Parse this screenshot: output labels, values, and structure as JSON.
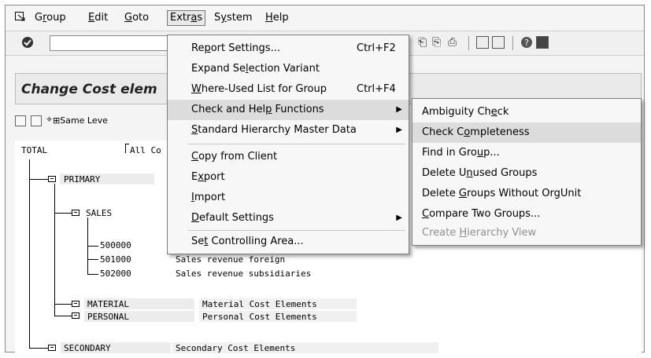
{
  "menubar": {
    "items": [
      {
        "pre": "G",
        "ul": "r",
        "post": "oup"
      },
      {
        "pre": "",
        "ul": "E",
        "post": "dit"
      },
      {
        "pre": "",
        "ul": "G",
        "post": "oto"
      },
      {
        "pre": "Extr",
        "ul": "a",
        "post": "s"
      },
      {
        "pre": "S",
        "ul": "y",
        "post": "stem"
      },
      {
        "pre": "",
        "ul": "H",
        "post": "elp"
      }
    ]
  },
  "page": {
    "title": "Change Cost elem",
    "same_level": "Same Leve"
  },
  "tree": {
    "root": {
      "id": "TOTAL",
      "desc": "All Co"
    },
    "primary": "PRIMARY",
    "sales": "SALES",
    "leaves": [
      {
        "id": "500000",
        "desc": ""
      },
      {
        "id": "501000",
        "desc": "Sales revenue foreign"
      },
      {
        "id": "502000",
        "desc": "Sales revenue subsidiaries"
      }
    ],
    "material": {
      "id": "MATERIAL",
      "desc": "Material Cost Elements"
    },
    "personal": {
      "id": "PERSONAL",
      "desc": "Personal Cost Elements"
    },
    "secondary": {
      "id": "SECONDARY",
      "desc": "Secondary Cost Elements"
    }
  },
  "extras_menu": [
    {
      "pre": "Re",
      "ul": "p",
      "post": "ort Settings...",
      "shortcut": "Ctrl+F2"
    },
    {
      "pre": "Expand Se",
      "ul": "l",
      "post": "ection Variant",
      "shortcut": ""
    },
    {
      "pre": "",
      "ul": "W",
      "post": "here-Used List for Group",
      "shortcut": "Ctrl+F4"
    },
    {
      "pre": "Check and Hel",
      "ul": "p",
      "post": " Functions",
      "shortcut": "",
      "submenu": true,
      "highlighted": true
    },
    {
      "pre": "",
      "ul": "S",
      "post": "tandard Hierarchy Master Data",
      "shortcut": "",
      "submenu": true
    },
    {
      "pre": "",
      "ul": "C",
      "post": "opy from Client",
      "shortcut": ""
    },
    {
      "pre": "E",
      "ul": "x",
      "post": "port",
      "shortcut": ""
    },
    {
      "pre": "",
      "ul": "I",
      "post": "mport",
      "shortcut": ""
    },
    {
      "pre": "",
      "ul": "D",
      "post": "efault Settings",
      "shortcut": "",
      "submenu": true
    },
    {
      "pre": "Se",
      "ul": "t",
      "post": " Controlling Area...",
      "shortcut": ""
    }
  ],
  "check_submenu": [
    {
      "pre": "Ambiguity Ch",
      "ul": "e",
      "post": "ck"
    },
    {
      "pre": "Check C",
      "ul": "o",
      "post": "mpleteness",
      "highlighted": true
    },
    {
      "pre": "Find in Gro",
      "ul": "u",
      "post": "p..."
    },
    {
      "pre": "Delete U",
      "ul": "n",
      "post": "used Groups"
    },
    {
      "pre": "Delete ",
      "ul": "G",
      "post": "roups Without OrgUnit"
    },
    {
      "pre": "",
      "ul": "C",
      "post": "ompare Two Groups..."
    },
    {
      "pre": "Create ",
      "ul": "H",
      "post": "ierarchy View",
      "disabled": true
    }
  ],
  "colors": {
    "menu_bg": "#f7f7f7",
    "highlight": "#dcdcdc",
    "disabled": "#8f8f8f",
    "node_bg": "#ececec"
  }
}
